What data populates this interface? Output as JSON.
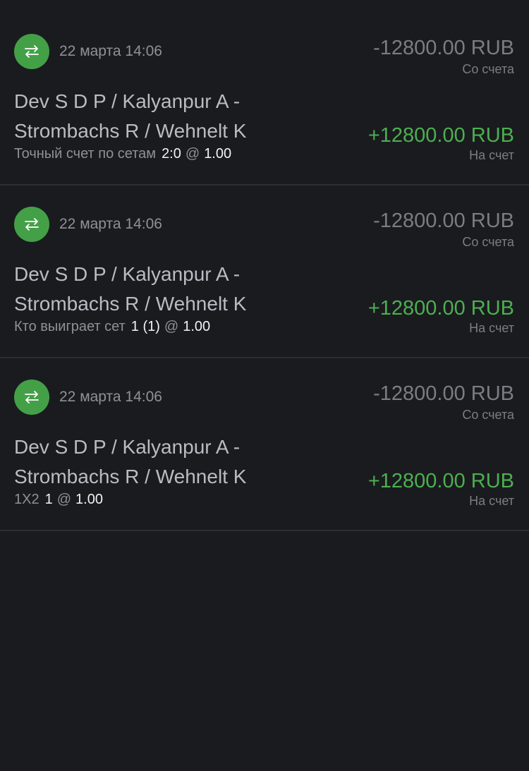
{
  "transactions": [
    {
      "icon": "transfer-arrows-icon",
      "date": "22 марта 14:06",
      "debit_amount": "-12800.00 RUB",
      "debit_label": "Со счета",
      "event_line1": "Dev S D P / Kalyanpur A -",
      "event_line2": "Strombachs R / Wehnelt K",
      "market": "Точный счет по сетам",
      "pick": "2:0",
      "at": "@",
      "odds": "1.00",
      "credit_amount": "+12800.00 RUB",
      "credit_label": "На счет"
    },
    {
      "icon": "transfer-arrows-icon",
      "date": "22 марта 14:06",
      "debit_amount": "-12800.00 RUB",
      "debit_label": "Со счета",
      "event_line1": "Dev S D P / Kalyanpur A -",
      "event_line2": "Strombachs R / Wehnelt K",
      "market": "Кто выиграет сет",
      "pick": "1 (1)",
      "at": "@",
      "odds": "1.00",
      "credit_amount": "+12800.00 RUB",
      "credit_label": "На счет"
    },
    {
      "icon": "transfer-arrows-icon",
      "date": "22 марта 14:06",
      "debit_amount": "-12800.00 RUB",
      "debit_label": "Со счета",
      "event_line1": "Dev S D P / Kalyanpur A -",
      "event_line2": "Strombachs R / Wehnelt K",
      "market": "1X2",
      "pick": "1",
      "at": "@",
      "odds": "1.00",
      "credit_amount": "+12800.00 RUB",
      "credit_label": "На счет"
    }
  ],
  "colors": {
    "background": "#1a1b1f",
    "accent_green": "#43a047",
    "credit_green": "#4caf50",
    "divider": "#2c2e33"
  }
}
